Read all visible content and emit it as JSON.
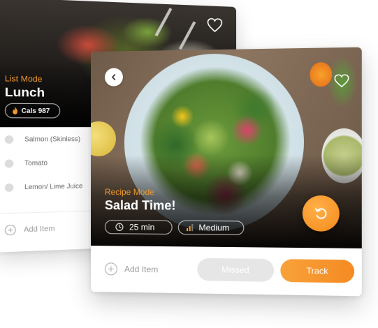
{
  "list_card": {
    "mode_label": "List Mode",
    "title": "Lunch",
    "calories_label": "Cals 987",
    "items": [
      {
        "label": "Salmon (Skinless)"
      },
      {
        "label": "Tomato"
      },
      {
        "label": "Lemon/ Lime Juice"
      }
    ],
    "add_item_label": "Add Item"
  },
  "recipe_card": {
    "mode_label": "Recipe Mode",
    "title": "Salad Time!",
    "time_label": "25 min",
    "difficulty_label": "Medium",
    "add_item_label": "Add Item",
    "missed_label": "Missed",
    "track_label": "Track"
  },
  "colors": {
    "accent": "#f5891a",
    "mode_label": "#f39a2b",
    "disabled_button": "#e6e6e6",
    "muted_text": "#9b9b9b"
  }
}
